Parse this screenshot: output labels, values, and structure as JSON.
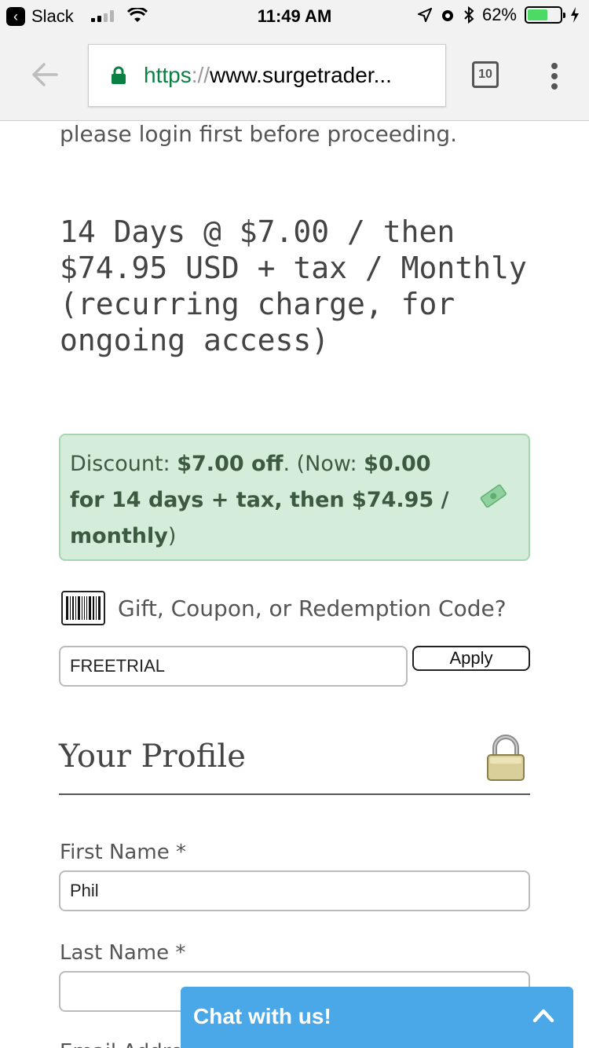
{
  "status_bar": {
    "back_app": "Slack",
    "time": "11:49 AM",
    "battery_percent": "62%",
    "battery_level": 0.62,
    "signal_bars_on": 2,
    "signal_bars_total": 4
  },
  "browser": {
    "url_scheme": "https",
    "url_sep": "://",
    "url_host": "www.surgetrader...",
    "tab_count": "10",
    "icons": [
      "back-arrow-icon",
      "lock-icon",
      "tabs-icon",
      "overflow-menu-icon"
    ]
  },
  "page": {
    "intro": "please login first before proceeding.",
    "price": "14 Days @ $7.00 / then $74.95 USD + tax / Monthly (recurring charge, for ongoing access)",
    "discount": {
      "label": "Discount:",
      "amount": "$7.00 off",
      "now_prefix": ". (Now: ",
      "now_detail": "$0.00 for 14 days + tax, then $74.95 / monthly",
      "close": ")"
    },
    "coupon": {
      "label": "Gift, Coupon, or Redemption Code?",
      "value": "FREETRIAL",
      "apply": "Apply"
    },
    "profile": {
      "title": "Your Profile",
      "first_name_label": "First Name *",
      "first_name_value": "Phil",
      "last_name_label": "Last Name *",
      "last_name_value": "",
      "email_label": "Email Address *"
    }
  },
  "chat": {
    "label": "Chat with us!"
  },
  "colors": {
    "url_green": "#0b8043",
    "discount_bg": "#d4edda",
    "chat_bg": "#4aa7e8",
    "battery_green": "#4cd964"
  }
}
